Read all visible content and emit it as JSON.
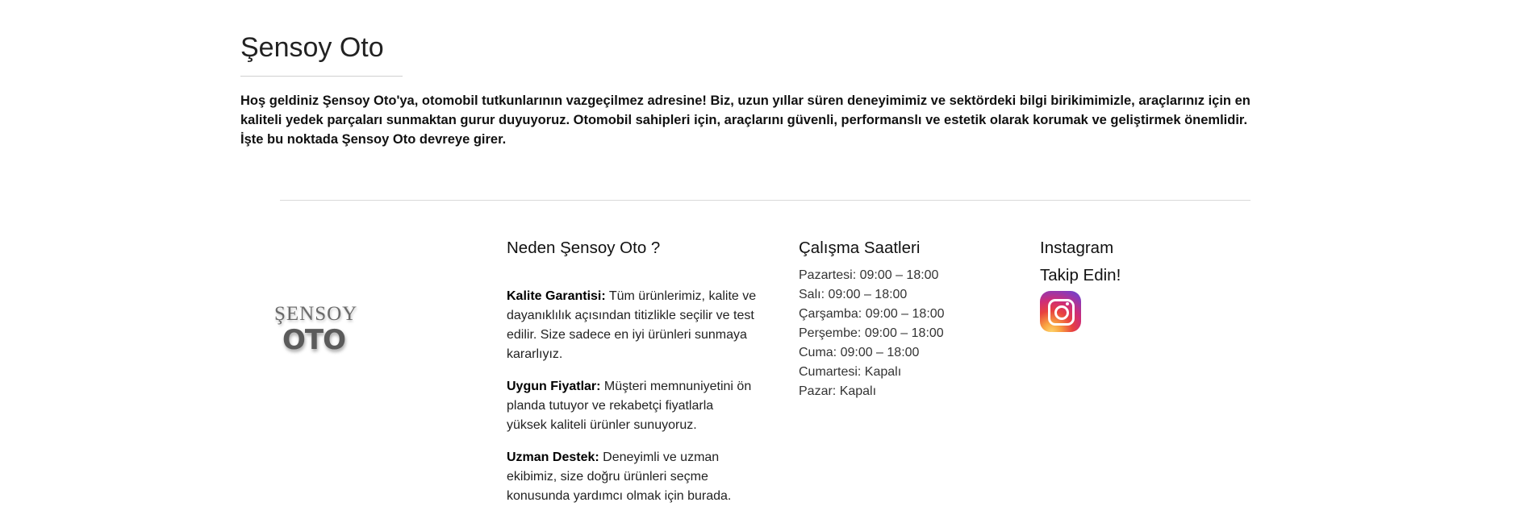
{
  "page": {
    "title": "Şensoy Oto",
    "intro": "Hoş geldiniz Şensoy Oto'ya, otomobil tutkunlarının vazgeçilmez adresine! Biz, uzun yıllar süren deneyimimiz ve sektördeki bilgi birikimimizle, araçlarınız için en kaliteli yedek parçaları sunmaktan gurur duyuyoruz. Otomobil sahipleri için, araçlarını güvenli, performanslı ve estetik olarak korumak ve geliştirmek önemlidir. İşte bu noktada Şensoy Oto devreye girer."
  },
  "logo": {
    "top": "ŞENSOY",
    "bottom": "OTO"
  },
  "why": {
    "title": "Neden Şensoy Oto ?",
    "items": [
      {
        "label": "Kalite Garantisi:",
        "text": " Tüm ürünlerimiz, kalite ve dayanıklılık açısından titizlikle seçilir ve test edilir. Size sadece en iyi ürünleri sunmaya kararlıyız."
      },
      {
        "label": "Uygun Fiyatlar:",
        "text": " Müşteri memnuniyetini ön planda tutuyor ve rekabetçi fiyatlarla yüksek kaliteli ürünler sunuyoruz."
      },
      {
        "label": "Uzman Destek:",
        "text": " Deneyimli ve uzman ekibimiz, size doğru ürünleri seçme konusunda yardımcı olmak için burada."
      }
    ]
  },
  "hours": {
    "title": "Çalışma Saatleri",
    "items": [
      "Pazartesi: 09:00 – 18:00",
      "Salı: 09:00 – 18:00",
      "Çarşamba: 09:00 – 18:00",
      "Perşembe: 09:00 – 18:00",
      "Cuma: 09:00 – 18:00",
      "Cumartesi: Kapalı",
      "Pazar: Kapalı"
    ]
  },
  "instagram": {
    "title": "Instagram",
    "follow": "Takip Edin!",
    "icon": "instagram-icon"
  }
}
